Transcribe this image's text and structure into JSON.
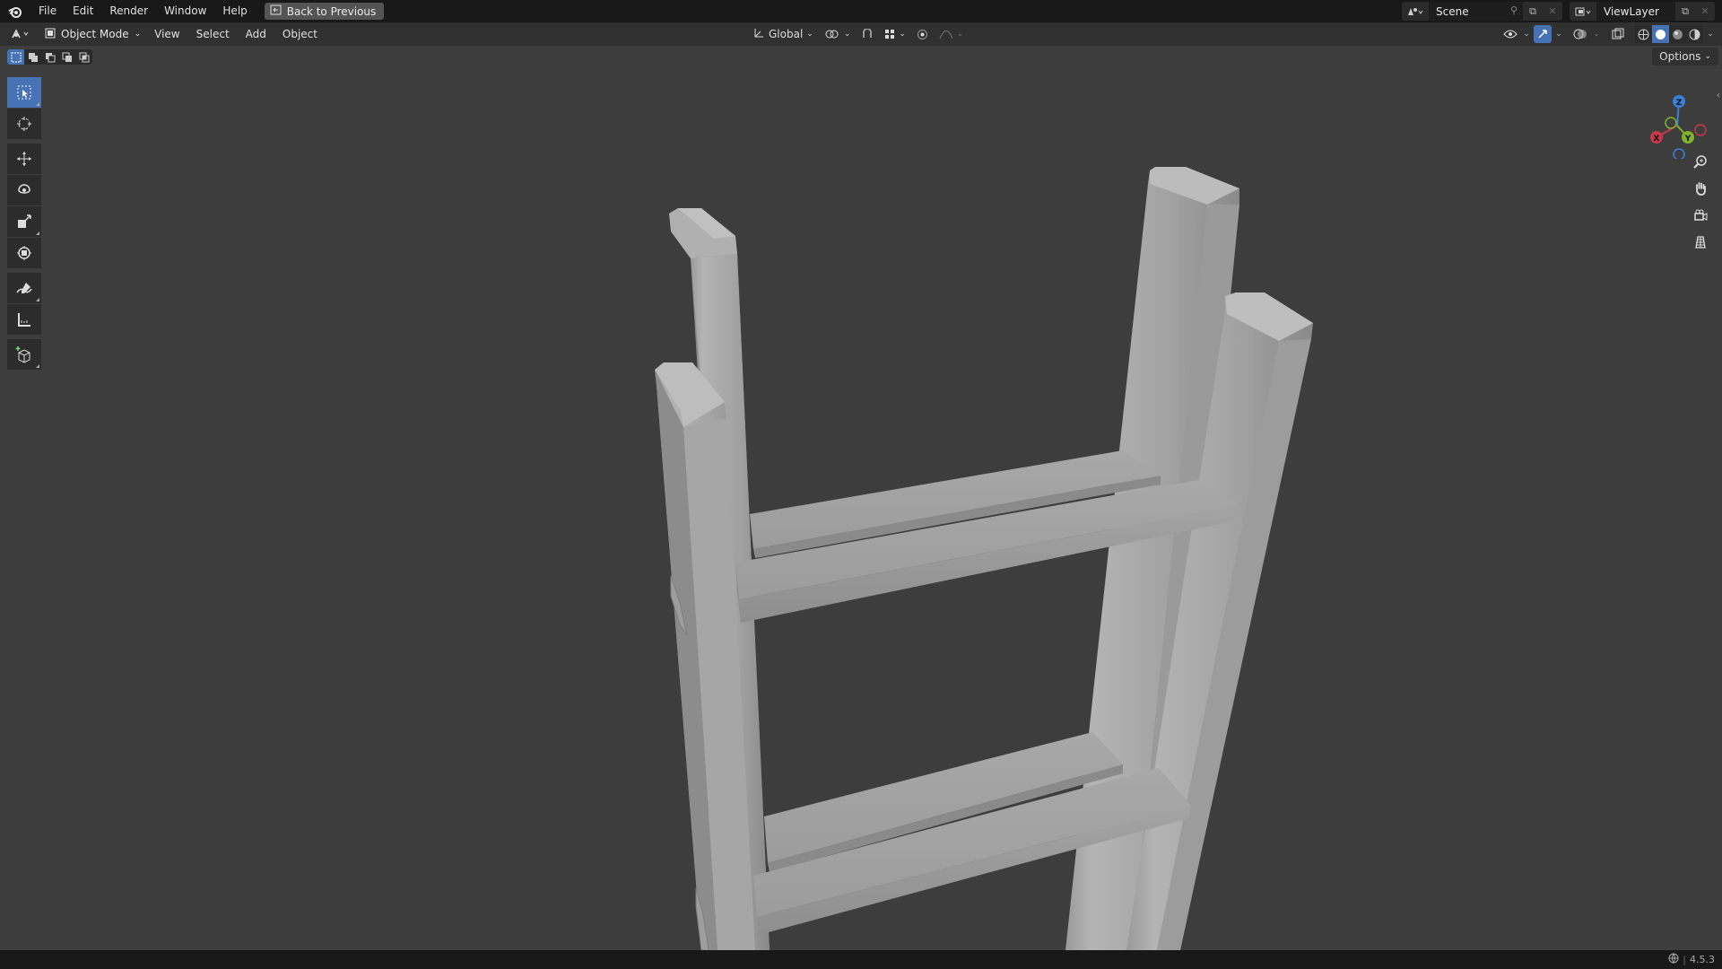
{
  "topbar": {
    "menus": [
      "File",
      "Edit",
      "Render",
      "Window",
      "Help"
    ],
    "back_button": "Back to Previous",
    "scene_name": "Scene",
    "view_layer_name": "ViewLayer"
  },
  "header": {
    "mode": "Object Mode",
    "menus": [
      "View",
      "Select",
      "Add",
      "Object"
    ],
    "transform_orientation": "Global"
  },
  "viewport": {
    "options_label": "Options",
    "gizmo_axes": {
      "x": "X",
      "y": "Y",
      "z": "Z"
    },
    "object": "ladder"
  },
  "statusbar": {
    "version": "4.5.3"
  },
  "colors": {
    "accent": "#4772b3",
    "x_axis": "#c7394a",
    "y_axis": "#7fb32e",
    "z_axis": "#3a7fd8"
  }
}
